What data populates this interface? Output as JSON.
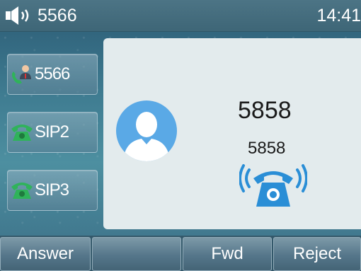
{
  "status_bar": {
    "account": "5566",
    "time": "14:41",
    "speaker_icon": "speaker-icon"
  },
  "line_keys": [
    {
      "label": "5566",
      "icon": "registered-user-phone-icon"
    },
    {
      "label": "SIP2",
      "icon": "phone-icon"
    },
    {
      "label": "SIP3",
      "icon": "phone-icon"
    }
  ],
  "call": {
    "caller_name": "5858",
    "caller_number": "5858",
    "state_icon": "ringing-phone-icon",
    "avatar_icon": "contact-avatar-icon"
  },
  "softkeys": [
    {
      "label": "Answer"
    },
    {
      "label": ""
    },
    {
      "label": "Fwd"
    },
    {
      "label": "Reject"
    }
  ],
  "colors": {
    "accent_blue": "#2a8ed6",
    "avatar_blue": "#5aa9e6",
    "phone_green": "#2fb35a"
  }
}
